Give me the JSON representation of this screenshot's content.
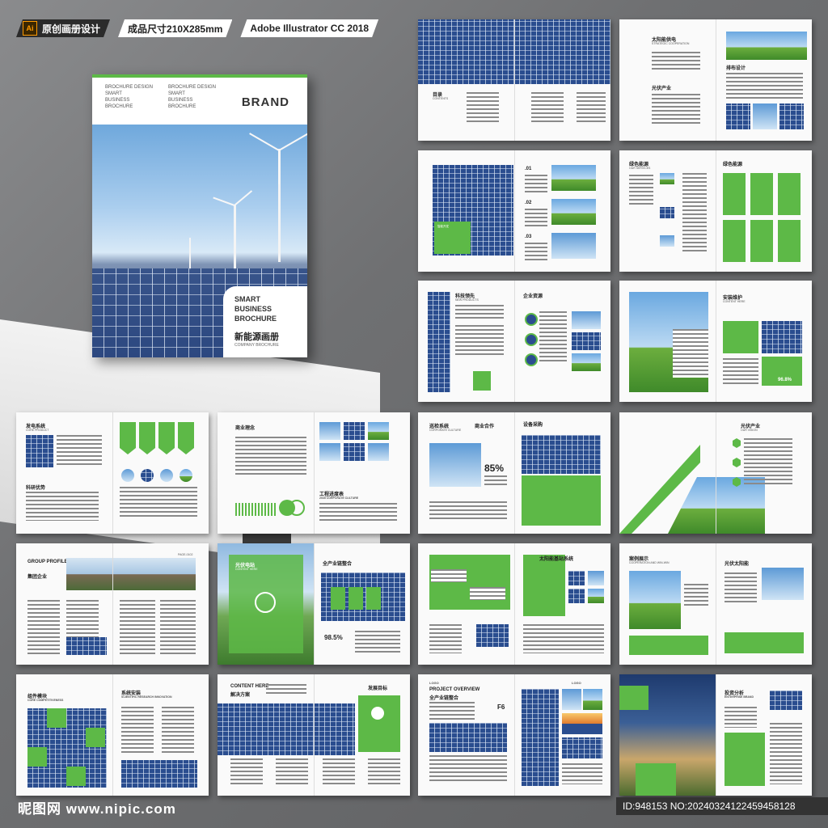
{
  "topbar": {
    "ai_icon": "Ai",
    "tag1": "原创画册设计",
    "tag2": "成品尺寸210X285mm",
    "tag3": "Adobe Illustrator CC 2018"
  },
  "cover": {
    "col1": [
      "BROCHURE DESIGN",
      "SMART",
      "BUSINESS",
      "BROCHURE"
    ],
    "col2": [
      "BROCHURE DESIGN",
      "SMART",
      "BUSINESS",
      "BROCHURE"
    ],
    "brand": "BRAND",
    "card_lines": [
      "SMART",
      "BUSINESS",
      "BROCHURE"
    ],
    "card_cn": "新能源画册",
    "card_en": "COMPANY BROCHURE"
  },
  "spreads": {
    "s1": {
      "title": "目录",
      "sub": "CONTENTS"
    },
    "s2": {
      "title": "太阳能供电",
      "sub": "STRATEGIC COOPERATION",
      "title2": "排布设计",
      "title3": "光伏产业"
    },
    "s3": {
      "n1": ".01",
      "n2": ".02",
      "n3": ".03",
      "label": "智能开发"
    },
    "s4": {
      "title": "绿色能源",
      "sub": "OUR SERVICES",
      "title2": "绿色能源"
    },
    "s5": {
      "title": "科技领先",
      "sub": "NEW PRODUCTS",
      "title2": "企业资源"
    },
    "s6": {
      "title": "安装维护",
      "sub": "CONTENT HERE",
      "pct": "96.8%"
    },
    "s7": {
      "title": "发电系统",
      "sub": "CORE PRODUCT",
      "title2": "科研优势"
    },
    "s8": {
      "title": "商业理念",
      "title2": "工程进度表",
      "sub2": "2035 CORPCRATE CULTURE"
    },
    "s9": {
      "title": "巡检系统",
      "sub": "CORPORATE CULTURE",
      "title2": "设备采购",
      "pct": "85%",
      "title3": "商业合作"
    },
    "s10": {
      "title": "光伏产业",
      "sub": "OUR VISION"
    },
    "s11": {
      "title": "GROUP PROFILE",
      "title_b": "集团企业",
      "sub": "PAGE-0102"
    },
    "s12": {
      "title": "光伏电站",
      "sub": "CONTENT HERE",
      "title2": "全产业链整合",
      "pct": "98.5%"
    },
    "s13": {
      "title": "太阳能基站系统"
    },
    "s14": {
      "title": "案例展示",
      "sub": "COOPERATION AND WIN-WIN",
      "title2": "光伏太阳能"
    },
    "s15": {
      "title": "组件模块",
      "sub": "CORE COMPETITIVENESS",
      "title2": "系统安装",
      "sub2": "SCIENTIFIC RESEARCH INNOVATION"
    },
    "s16": {
      "title": "CONTENT HERE",
      "title_b": "解决方案",
      "title2": "发展目标"
    },
    "s17": {
      "title": "PROJECT OVERVIEW",
      "title_b": "全产业链整合",
      "tag": "F6",
      "logo": "LOGO"
    },
    "s18": {
      "title": "投资分析",
      "sub": "ENTERPRISE BRAND"
    }
  },
  "footer": {
    "left": "昵图网 www.nipic.com",
    "right": "ID:948153 NO:20240324122459458128"
  },
  "colors": {
    "accent": "#5db947",
    "dark_bg": "#6d6e70",
    "panel_blue": "#2a4d8f"
  }
}
